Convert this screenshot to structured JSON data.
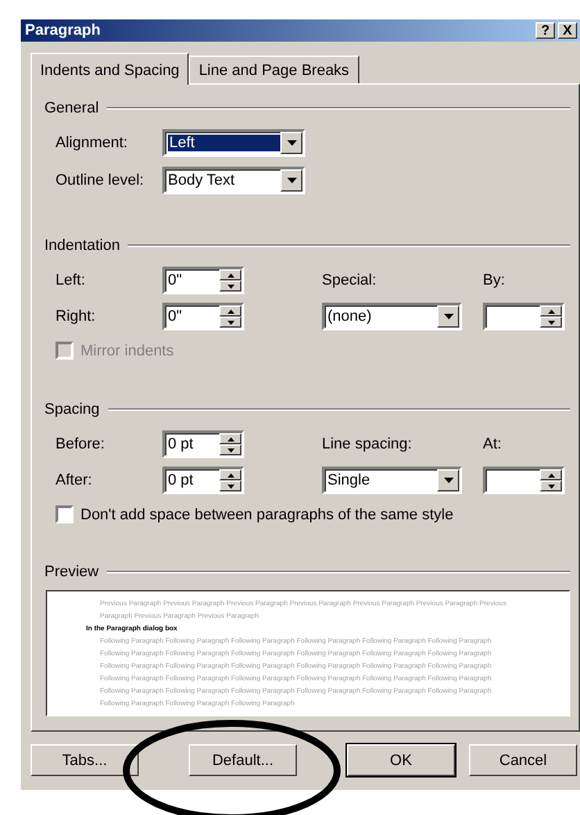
{
  "window": {
    "title": "Paragraph",
    "help_button": "?",
    "close_button": "X"
  },
  "tabs": [
    {
      "label": "Indents and Spacing",
      "selected": true
    },
    {
      "label": "Line and Page Breaks",
      "selected": false
    }
  ],
  "general": {
    "title": "General",
    "fields": [
      {
        "label": "Alignment:",
        "value": "Left",
        "focused": true
      },
      {
        "label": "Outline level:",
        "value": "Body Text",
        "focused": false
      }
    ]
  },
  "indentation": {
    "title": "Indentation",
    "left": {
      "label": "Left:",
      "value": "0\""
    },
    "right": {
      "label": "Right:",
      "value": "0\""
    },
    "special": {
      "label": "Special:",
      "value": "(none)"
    },
    "by": {
      "label": "By:"
    },
    "mirror": {
      "label": "Mirror indents",
      "checked": false,
      "disabled": true
    }
  },
  "spacing": {
    "title": "Spacing",
    "before": {
      "label": "Before:",
      "value": "0 pt"
    },
    "after": {
      "label": "After:",
      "value": "0 pt"
    },
    "line_spacing": {
      "label": "Line spacing:",
      "value": "Single"
    },
    "at": {
      "label": "At:"
    },
    "no_space": {
      "label": "Don't add space between paragraphs of the same style",
      "checked": false,
      "disabled": false
    }
  },
  "preview": {
    "title": "Preview",
    "previous": "Previous Paragraph Previous Paragraph Previous Paragraph Previous Paragraph Previous Paragraph Previous Paragraph Previous Paragraph Previous Paragraph Previous Paragraph",
    "sample": "In the Paragraph dialog box",
    "following": "Following Paragraph Following Paragraph Following Paragraph Following Paragraph Following Paragraph Following Paragraph Following Paragraph Following Paragraph Following Paragraph Following Paragraph Following Paragraph Following Paragraph Following Paragraph Following Paragraph Following Paragraph Following Paragraph Following Paragraph Following Paragraph Following Paragraph Following Paragraph Following Paragraph Following Paragraph Following Paragraph Following Paragraph Following Paragraph Following Paragraph Following Paragraph Following Paragraph Following Paragraph Following Paragraph Following Paragraph Following Paragraph Following Paragraph"
  },
  "buttons": [
    {
      "label": "Tabs...",
      "default": false
    },
    {
      "label": "Default...",
      "default": false
    },
    {
      "label": "OK",
      "default": true
    },
    {
      "label": "Cancel",
      "default": false
    }
  ],
  "annotation": {
    "kind": "ellipse"
  }
}
